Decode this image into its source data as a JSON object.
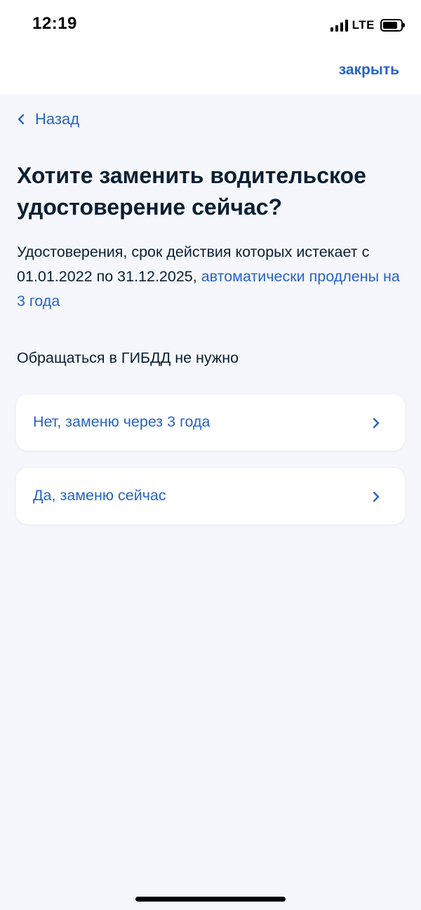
{
  "status_bar": {
    "time": "12:19",
    "network": "LTE",
    "icons": [
      "signal-icon",
      "battery-icon"
    ]
  },
  "header": {
    "close_label": "закрыть"
  },
  "back": {
    "label": "Назад",
    "icon": "chevron-left-icon"
  },
  "main": {
    "title": "Хотите заменить водительское удостоверение сейчас?",
    "description_text": "Удостоверения, срок действия которых истекает с 01.01.2022 по 31.12.2025, ",
    "description_link": "автоматически продлены на 3 года",
    "note": "Обращаться в ГИБДД не нужно",
    "options": [
      {
        "label": "Нет, заменю через 3 года",
        "icon": "chevron-right-icon"
      },
      {
        "label": "Да, заменю сейчас",
        "icon": "chevron-right-icon"
      }
    ]
  },
  "colors": {
    "accent": "#2763c6",
    "text": "#0b1f33",
    "background": "#f5f7fc",
    "card": "#ffffff"
  }
}
